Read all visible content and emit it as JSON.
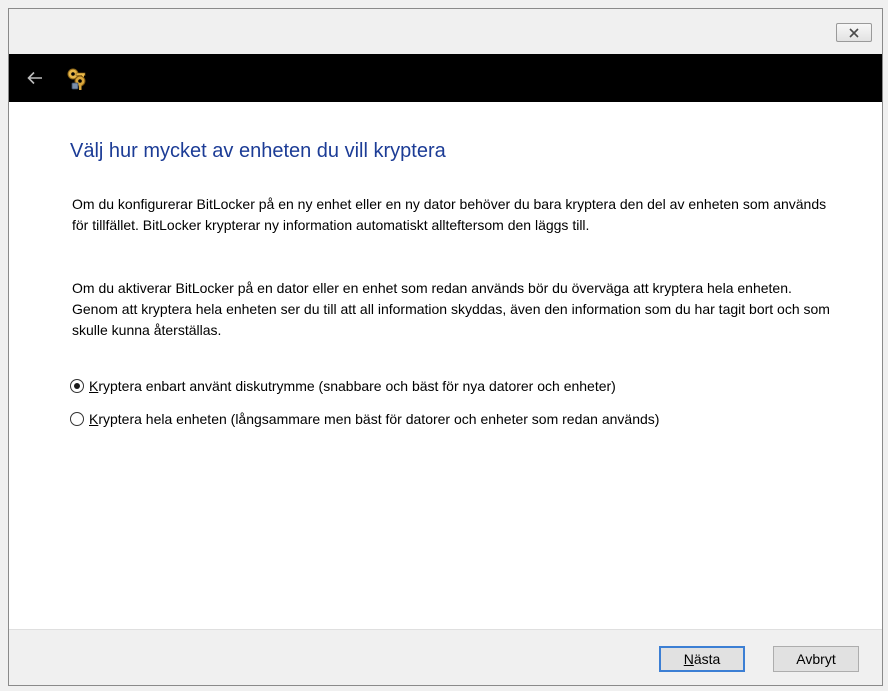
{
  "window": {
    "close_symbol": "✕"
  },
  "navbar": {
    "back_icon": "back-arrow-icon",
    "app_icon": "bitlocker-keys-icon"
  },
  "content": {
    "heading": "Välj hur mycket av enheten du vill kryptera",
    "paragraph1": "Om du konfigurerar BitLocker på en ny enhet eller en ny dator behöver du bara kryptera den del av enheten som används för tillfället. BitLocker krypterar ny information automatiskt allteftersom den läggs till.",
    "paragraph2": "Om du aktiverar BitLocker på en dator eller en enhet som redan används bör du överväga att kryptera hela enheten. Genom att kryptera hela enheten ser du till att all information skyddas, även den information som du har tagit bort och som skulle kunna återställas.",
    "options": [
      {
        "accel": "K",
        "rest": "ryptera enbart använt diskutrymme (snabbare och bäst för nya datorer och enheter)",
        "selected": true
      },
      {
        "accel": "K",
        "rest": "ryptera hela enheten (långsammare men bäst för datorer och enheter som redan används)",
        "selected": false
      }
    ]
  },
  "footer": {
    "next_accel": "N",
    "next_rest": "ästa",
    "cancel_label": "Avbryt"
  },
  "colors": {
    "heading": "#1c3c96",
    "navbar": "#000000",
    "default_button_border": "#3c7fd4"
  }
}
